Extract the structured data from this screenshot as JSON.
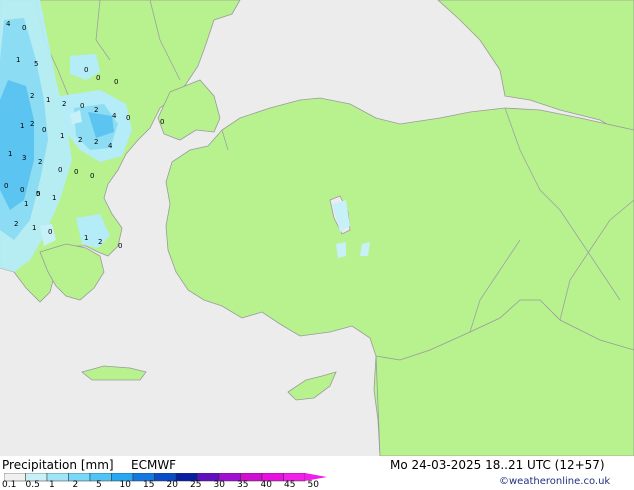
{
  "map": {
    "colors": {
      "land": "#b7f28f",
      "sea": "#ececec",
      "border": "#a0a0a0",
      "coast": "#9a9a9a"
    },
    "precip_labels": [
      "4",
      "0",
      "1",
      "5",
      "0",
      "0",
      "0",
      "2",
      "1",
      "0",
      "2",
      "2",
      "4",
      "0",
      "1",
      "2",
      "0",
      "1",
      "2",
      "2",
      "4",
      "1",
      "3",
      "2",
      "0",
      "0",
      "0",
      "0",
      "0",
      "0",
      "1",
      "5",
      "1",
      "2",
      "1",
      "0",
      "1",
      "2",
      "0",
      "0"
    ]
  },
  "footer": {
    "title": "Precipitation [mm]",
    "model": "ECMWF",
    "datetime": "Mo 24-03-2025 18..21 UTC (12+57)",
    "credit": "©weatheronline.co.uk",
    "scale_ticks": [
      "0.1",
      "0.5",
      "1",
      "2",
      "5",
      "10",
      "15",
      "20",
      "25",
      "30",
      "35",
      "40",
      "45",
      "50"
    ],
    "scale_colors": [
      "#f0f0f0",
      "#c8f0f8",
      "#a0e4f8",
      "#78d8f8",
      "#50c4f4",
      "#28a8f0",
      "#1478e0",
      "#0a4cc8",
      "#0820a0",
      "#6010c0",
      "#a010d0",
      "#d010d0",
      "#e810e0",
      "#f020e8"
    ]
  }
}
